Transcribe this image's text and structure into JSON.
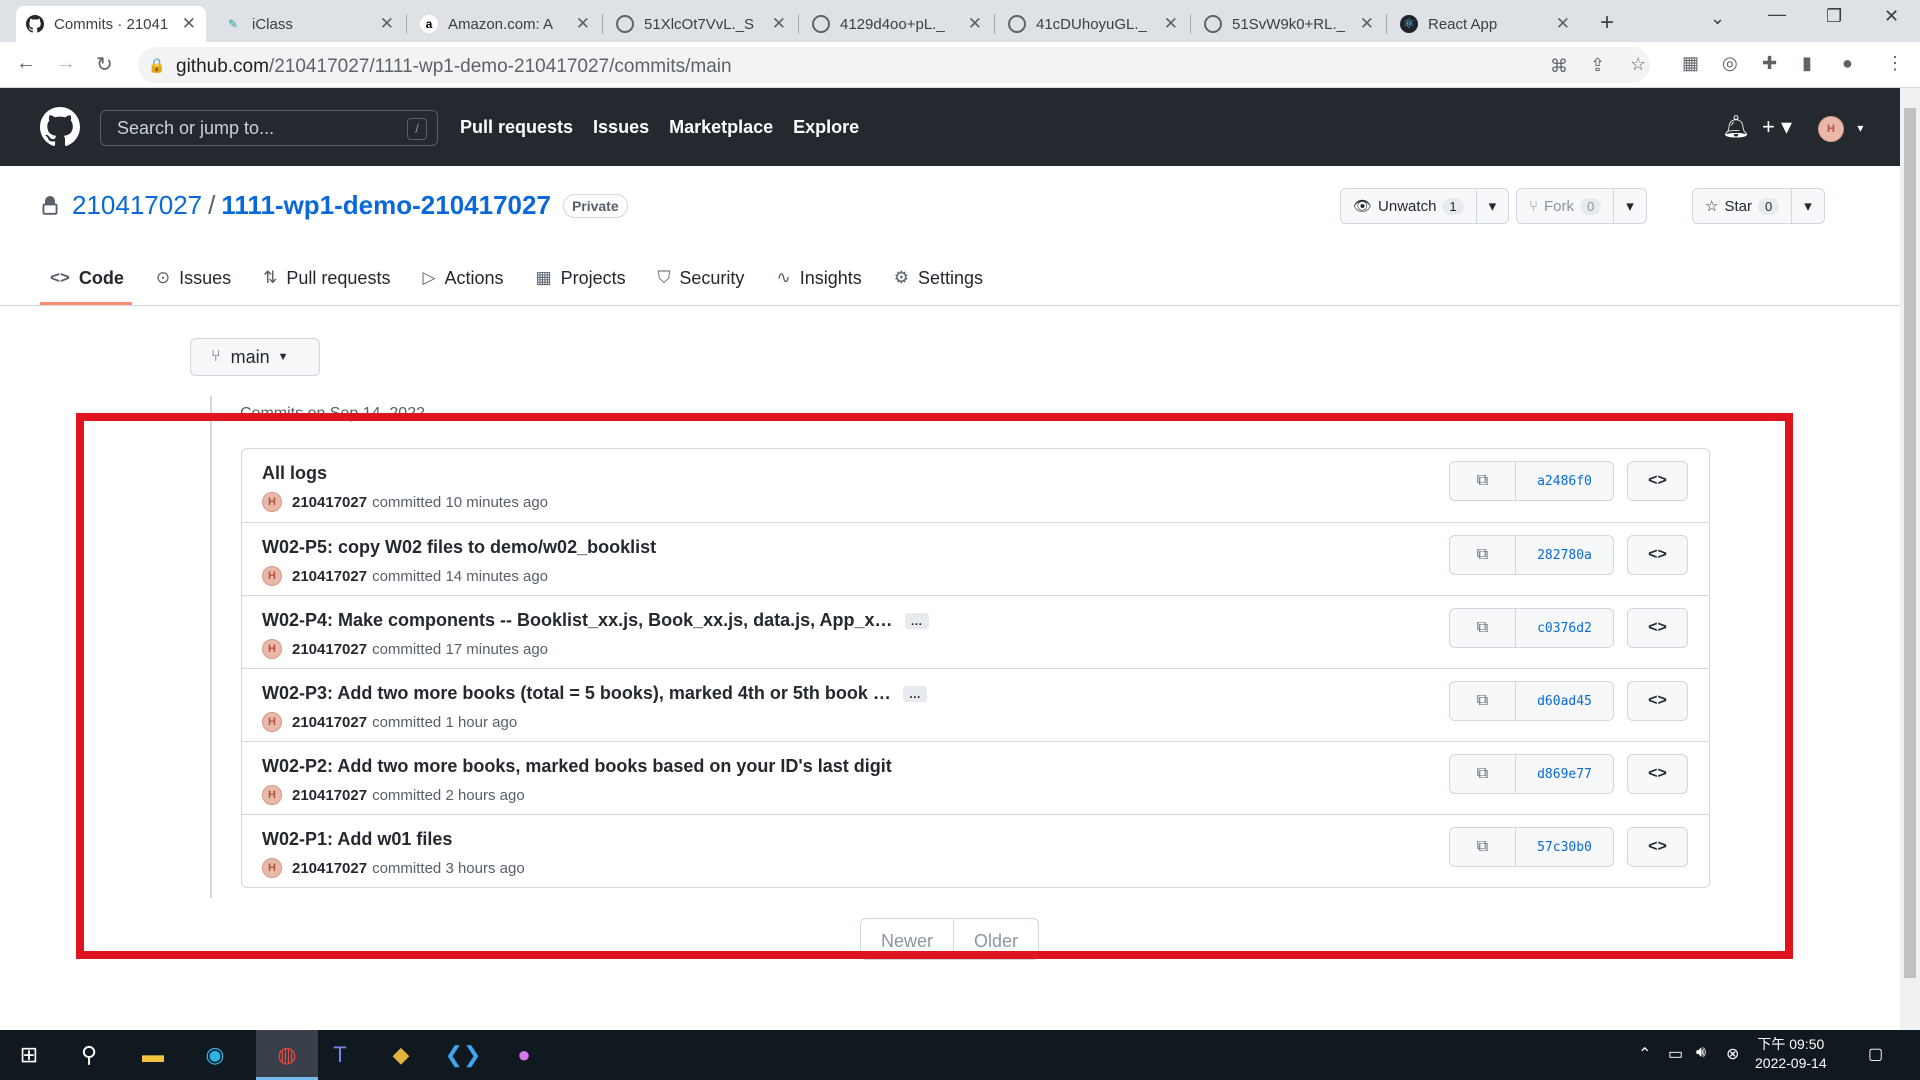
{
  "browser": {
    "tabs": [
      {
        "label": "Commits · 21041",
        "favicon": "github-icon",
        "active": true
      },
      {
        "label": "iClass",
        "favicon": "iclass-icon"
      },
      {
        "label": "Amazon.com: A",
        "favicon": "amazon-icon"
      },
      {
        "label": "51XlcOt7VvL._S",
        "favicon": "globe-icon"
      },
      {
        "label": "4129d4oo+pL._",
        "favicon": "globe-icon"
      },
      {
        "label": "41cDUhoyuGL._",
        "favicon": "globe-icon"
      },
      {
        "label": "51SvW9k0+RL._",
        "favicon": "globe-icon"
      },
      {
        "label": "React App",
        "favicon": "react-icon"
      }
    ],
    "url_host": "github.com",
    "url_path": "/210417027/1111-wp1-demo-210417027/commits/main"
  },
  "github": {
    "search_placeholder": "Search or jump to...",
    "search_shortcut": "/",
    "nav": [
      "Pull requests",
      "Issues",
      "Marketplace",
      "Explore"
    ]
  },
  "repo": {
    "owner": "210417027",
    "name": "1111-wp1-demo-210417027",
    "visibility": "Private",
    "watch_label": "Unwatch",
    "watch_count": "1",
    "fork_label": "Fork",
    "fork_count": "0",
    "star_label": "Star",
    "star_count": "0",
    "tabs": [
      "Code",
      "Issues",
      "Pull requests",
      "Actions",
      "Projects",
      "Security",
      "Insights",
      "Settings"
    ]
  },
  "branch": "main",
  "commits_date": "Commits on Sep 14, 2022",
  "commits": [
    {
      "message": "All logs",
      "author": "210417027",
      "time": "committed 10 minutes ago",
      "sha": "a2486f0",
      "more": ""
    },
    {
      "message": "W02-P5: copy W02 files to demo/w02_booklist",
      "author": "210417027",
      "time": "committed 14 minutes ago",
      "sha": "282780a",
      "more": ""
    },
    {
      "message": "W02-P4: Make components -- Booklist_xx.js, Book_xx.js, data.js, App_x…",
      "author": "210417027",
      "time": "committed 17 minutes ago",
      "sha": "c0376d2",
      "more": "…"
    },
    {
      "message": "W02-P3: Add two more books (total = 5 books), marked 4th or 5th book …",
      "author": "210417027",
      "time": "committed 1 hour ago",
      "sha": "d60ad45",
      "more": "…"
    },
    {
      "message": "W02-P2: Add two more books, marked books based on your ID's last digit",
      "author": "210417027",
      "time": "committed 2 hours ago",
      "sha": "d869e77",
      "more": ""
    },
    {
      "message": "W02-P1: Add w01 files",
      "author": "210417027",
      "time": "committed 3 hours ago",
      "sha": "57c30b0",
      "more": ""
    }
  ],
  "pagination": {
    "newer": "Newer",
    "older": "Older"
  },
  "taskbar": {
    "time": "下午 09:50",
    "date": "2022-09-14"
  },
  "colors": {
    "highlight": "#e0141e",
    "header_bg": "#24292f",
    "link": "#0969da",
    "tab_underline": "#fd8c73"
  }
}
